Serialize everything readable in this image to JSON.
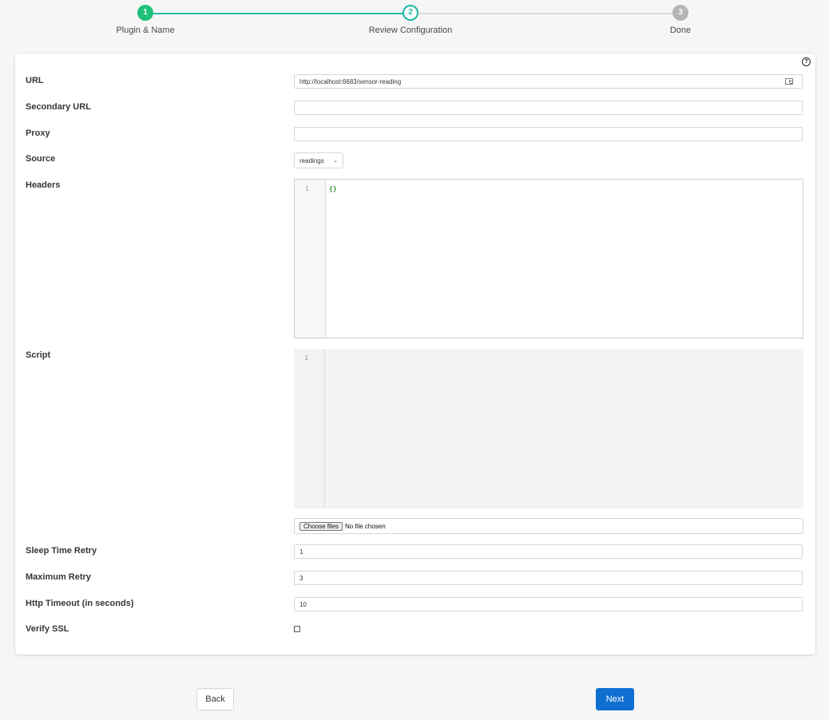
{
  "stepper": {
    "steps": [
      {
        "number": "1",
        "label": "Plugin & Name",
        "state": "complete"
      },
      {
        "number": "2",
        "label": "Review Configuration",
        "state": "active"
      },
      {
        "number": "3",
        "label": "Done",
        "state": "pending"
      }
    ]
  },
  "form": {
    "help_icon": "question-circle-icon",
    "url": {
      "label": "URL",
      "value": "http://localhost:6683/sensor-reading",
      "icon": "address-card-icon"
    },
    "secondary_url": {
      "label": "Secondary URL",
      "value": ""
    },
    "proxy": {
      "label": "Proxy",
      "value": ""
    },
    "source": {
      "label": "Source",
      "value": "readings"
    },
    "headers": {
      "label": "Headers",
      "line_number": "1",
      "code": "{}"
    },
    "script": {
      "label": "Script",
      "line_number": "1",
      "code": ""
    },
    "file_input": {
      "button_label": "Choose files",
      "status": "No file chosen"
    },
    "sleep_time_retry": {
      "label": "Sleep Time Retry",
      "value": "1"
    },
    "maximum_retry": {
      "label": "Maximum Retry",
      "value": "3"
    },
    "http_timeout": {
      "label": "Http Timeout (in seconds)",
      "value": "10"
    },
    "verify_ssl": {
      "label": "Verify SSL",
      "checked": false
    }
  },
  "footer": {
    "back_label": "Back",
    "next_label": "Next"
  },
  "colors": {
    "step_complete": "#1ec27a",
    "step_active": "#1fb9a4",
    "step_pending": "#b5b5b5",
    "primary_button": "#0f6fd1"
  }
}
